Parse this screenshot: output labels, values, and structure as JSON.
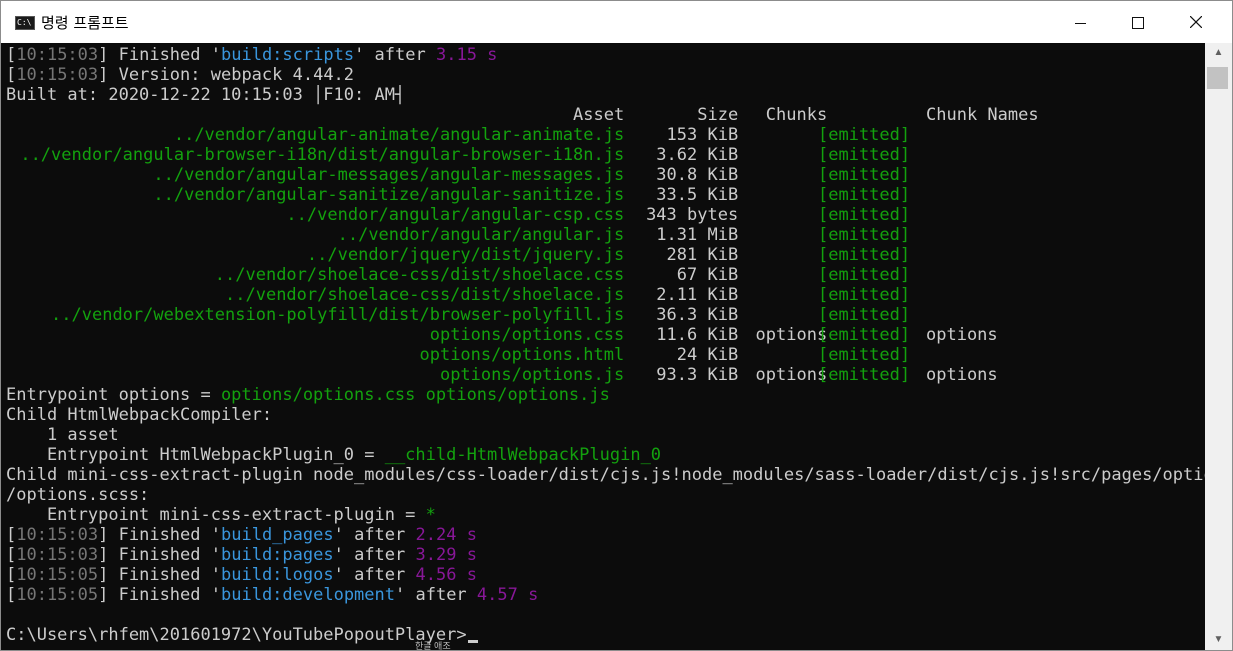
{
  "window": {
    "title": "명령 프롬프트",
    "icon": "cmd-icon",
    "icon_text": "C:\\",
    "controls": [
      "minimize-icon",
      "maximize-icon",
      "close-icon"
    ]
  },
  "colors": {
    "background": "#0c0c0c",
    "text": "#cccccc",
    "timestamp": "#767676",
    "task": "#3a96dd",
    "duration": "#881798",
    "emitted": "#13a10e"
  },
  "log_before": [
    {
      "time": "10:15:03",
      "word": "Finished",
      "task": "build:scripts",
      "after": "after",
      "dur": "3.15 s"
    }
  ],
  "version": {
    "time": "10:15:03",
    "text": "Version: webpack 4.44.2"
  },
  "built_at": "Built at: 2020-12-22 10:15:03 │F10: AM┤",
  "asset_header": {
    "asset": "Asset",
    "size": "Size",
    "chunks": "Chunks",
    "chunk_names": "Chunk Names"
  },
  "assets": [
    {
      "name": "../vendor/angular-animate/angular-animate.js",
      "size": "153 KiB",
      "chunks": "",
      "status": "[emitted]",
      "names": ""
    },
    {
      "name": "../vendor/angular-browser-i18n/dist/angular-browser-i18n.js",
      "size": "3.62 KiB",
      "chunks": "",
      "status": "[emitted]",
      "names": ""
    },
    {
      "name": "../vendor/angular-messages/angular-messages.js",
      "size": "30.8 KiB",
      "chunks": "",
      "status": "[emitted]",
      "names": ""
    },
    {
      "name": "../vendor/angular-sanitize/angular-sanitize.js",
      "size": "33.5 KiB",
      "chunks": "",
      "status": "[emitted]",
      "names": ""
    },
    {
      "name": "../vendor/angular/angular-csp.css",
      "size": "343 bytes",
      "chunks": "",
      "status": "[emitted]",
      "names": ""
    },
    {
      "name": "../vendor/angular/angular.js",
      "size": "1.31 MiB",
      "chunks": "",
      "status": "[emitted]",
      "names": ""
    },
    {
      "name": "../vendor/jquery/dist/jquery.js",
      "size": "281 KiB",
      "chunks": "",
      "status": "[emitted]",
      "names": ""
    },
    {
      "name": "../vendor/shoelace-css/dist/shoelace.css",
      "size": "67 KiB",
      "chunks": "",
      "status": "[emitted]",
      "names": ""
    },
    {
      "name": "../vendor/shoelace-css/dist/shoelace.js",
      "size": "2.11 KiB",
      "chunks": "",
      "status": "[emitted]",
      "names": ""
    },
    {
      "name": "../vendor/webextension-polyfill/dist/browser-polyfill.js",
      "size": "36.3 KiB",
      "chunks": "",
      "status": "[emitted]",
      "names": ""
    },
    {
      "name": "options/options.css",
      "size": "11.6 KiB",
      "chunks": "options",
      "status": "[emitted]",
      "names": "options"
    },
    {
      "name": "options/options.html",
      "size": "24 KiB",
      "chunks": "",
      "status": "[emitted]",
      "names": ""
    },
    {
      "name": "options/options.js",
      "size": "93.3 KiB",
      "chunks": "options",
      "status": "[emitted]",
      "names": "options"
    }
  ],
  "entrypoint": {
    "label": "Entrypoint options = ",
    "files": "options/options.css options/options.js"
  },
  "child_html": {
    "title": "Child HtmlWebpackCompiler:",
    "asset_count": "    1 asset",
    "entry_label": "    Entrypoint HtmlWebpackPlugin_0 = ",
    "entry_value": "__child-HtmlWebpackPlugin_0"
  },
  "child_css": {
    "line1": "Child mini-css-extract-plugin node_modules/css-loader/dist/cjs.js!node_modules/sass-loader/dist/cjs.js!src/pages/options",
    "line2": "/options.scss:",
    "entry_label": "    Entrypoint mini-css-extract-plugin = ",
    "entry_value": "*"
  },
  "log_after": [
    {
      "time": "10:15:03",
      "word": "Finished",
      "task": "build_pages",
      "after": "after",
      "dur": "2.24 s"
    },
    {
      "time": "10:15:03",
      "word": "Finished",
      "task": "build:pages",
      "after": "after",
      "dur": "3.29 s"
    },
    {
      "time": "10:15:05",
      "word": "Finished",
      "task": "build:logos",
      "after": "after",
      "dur": "4.56 s"
    },
    {
      "time": "10:15:05",
      "word": "Finished",
      "task": "build:development",
      "after": "after",
      "dur": "4.57 s"
    }
  ],
  "prompt": "C:\\Users\\rhfem\\201601972\\YouTubePopoutPlayer>",
  "ime_indicator": "한글 애조",
  "scrollbar": {
    "up": "▲",
    "down": "▼"
  }
}
